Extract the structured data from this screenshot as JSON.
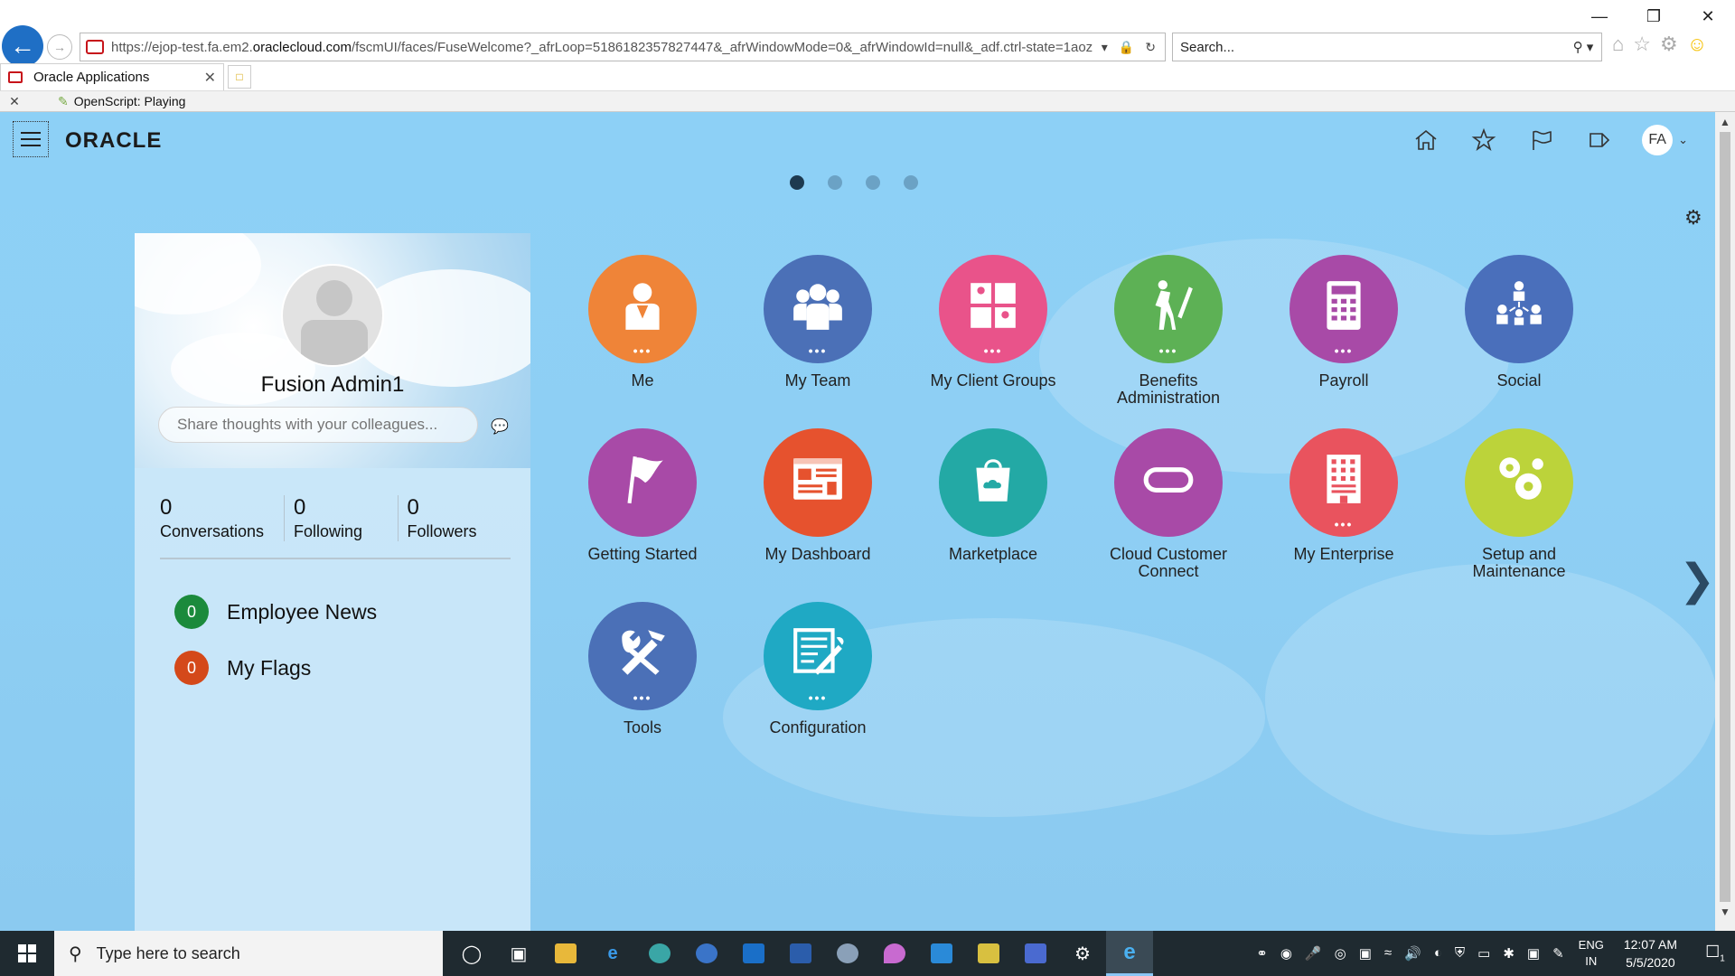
{
  "browser": {
    "url_prefix": "https://ejop-test.fa.em2.",
    "url_domain": "oraclecloud.com",
    "url_suffix": "/fscmUI/faces/FuseWelcome?_afrLoop=5186182357827447&_afrWindowMode=0&_afrWindowId=null&_adf.ctrl-state=1aoz",
    "search_placeholder": "Search...",
    "tab_title": "Oracle Applications",
    "command_bar_text": "OpenScript: Playing"
  },
  "app": {
    "logo": "ORACLE",
    "avatar_initials": "FA",
    "page_dots": 4,
    "active_page": 1
  },
  "profile": {
    "name": "Fusion Admin1",
    "share_placeholder": "Share thoughts with your colleagues...",
    "stats": [
      {
        "value": "0",
        "label": "Conversations"
      },
      {
        "value": "0",
        "label": "Following"
      },
      {
        "value": "0",
        "label": "Followers"
      }
    ],
    "news": [
      {
        "count": "0",
        "label": "Employee News",
        "color": "#1b8a3c"
      },
      {
        "count": "0",
        "label": "My Flags",
        "color": "#d4491a"
      }
    ]
  },
  "springboard": [
    {
      "label": "Me",
      "color": "#ef8438",
      "icon": "person-icon"
    },
    {
      "label": "My Team",
      "color": "#4b70b7",
      "icon": "team-icon"
    },
    {
      "label": "My Client Groups",
      "color": "#e9538a",
      "icon": "client-groups-icon"
    },
    {
      "label": "Benefits Administration",
      "color": "#5db155",
      "icon": "benefits-icon"
    },
    {
      "label": "Payroll",
      "color": "#a84aa7",
      "icon": "calculator-icon"
    },
    {
      "label": "Social",
      "color": "#4a6fbb",
      "icon": "org-chart-icon"
    },
    {
      "label": "Getting Started",
      "color": "#a84aa7",
      "icon": "flag-icon"
    },
    {
      "label": "My Dashboard",
      "color": "#e6522e",
      "icon": "dashboard-icon"
    },
    {
      "label": "Marketplace",
      "color": "#23a9a5",
      "icon": "shopping-bag-icon"
    },
    {
      "label": "Cloud Customer Connect",
      "color": "#a84aa7",
      "icon": "connect-icon"
    },
    {
      "label": "My Enterprise",
      "color": "#e9535e",
      "icon": "building-icon"
    },
    {
      "label": "Setup and Maintenance",
      "color": "#bcd33a",
      "icon": "gears-icon"
    },
    {
      "label": "Tools",
      "color": "#4b70b7",
      "icon": "tools-icon"
    },
    {
      "label": "Configuration",
      "color": "#1fa9c4",
      "icon": "configuration-icon"
    }
  ],
  "taskbar": {
    "search_placeholder": "Type here to search",
    "lang_top": "ENG",
    "lang_bottom": "IN",
    "time": "12:07 AM",
    "date": "5/5/2020",
    "notification_count": "1"
  }
}
